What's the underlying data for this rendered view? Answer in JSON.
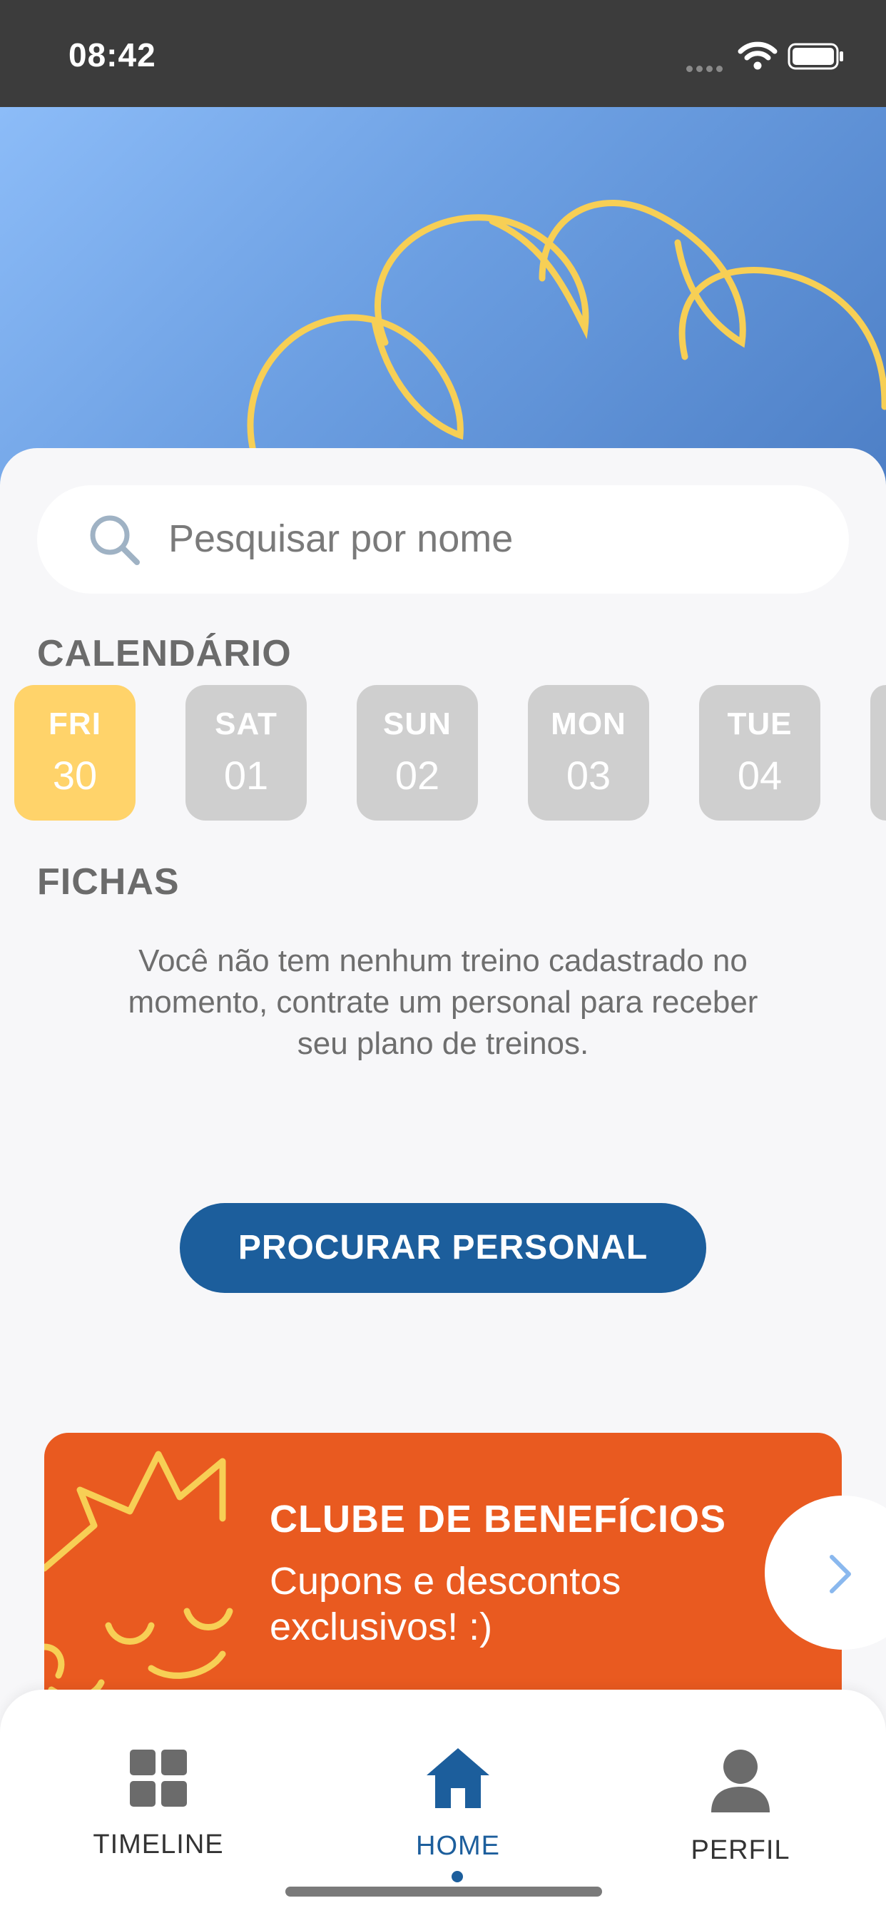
{
  "status_bar": {
    "time": "08:42"
  },
  "search": {
    "placeholder": "Pesquisar por nome",
    "icon": "search-icon"
  },
  "calendar": {
    "title": "CALENDÁRIO",
    "days": [
      {
        "name": "FRI",
        "number": "30",
        "selected": true
      },
      {
        "name": "SAT",
        "number": "01",
        "selected": false
      },
      {
        "name": "SUN",
        "number": "02",
        "selected": false
      },
      {
        "name": "MON",
        "number": "03",
        "selected": false
      },
      {
        "name": "TUE",
        "number": "04",
        "selected": false
      }
    ]
  },
  "fichas": {
    "title": "FICHAS",
    "empty_message": "Você não tem nenhum treino cadastrado no momento, contrate um personal para receber seu plano de treinos."
  },
  "actions": {
    "find_personal_label": "PROCURAR PERSONAL"
  },
  "benefits": {
    "title": "CLUBE DE BENEFÍCIOS",
    "subtitle": "Cupons e descontos exclusivos! :)",
    "next_icon": "chevron-right-icon"
  },
  "tab_bar": {
    "items": [
      {
        "label": "TIMELINE",
        "icon": "grid-icon",
        "active": false
      },
      {
        "label": "HOME",
        "icon": "home-icon",
        "active": true
      },
      {
        "label": "PERFIL",
        "icon": "user-icon",
        "active": false
      }
    ]
  },
  "colors": {
    "accent_blue": "#1c5e9c",
    "selected_day": "#ffd36a",
    "unselected_day": "#cfcfcf",
    "banner_orange": "#e95a20",
    "hero_gradient_start": "#8cbcf8",
    "hero_gradient_end": "#4d7fc6",
    "hero_rings": "#f7cf55"
  }
}
